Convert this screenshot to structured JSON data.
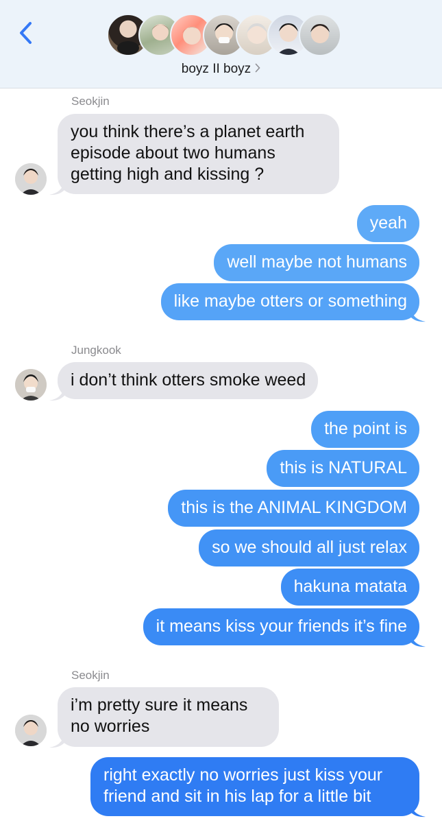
{
  "header": {
    "group_name": "boyz II boyz",
    "back_icon": "chevron-left-icon",
    "accent": "#3478f6"
  },
  "messages": [
    {
      "sender": "Seokjin",
      "text": "you think there’s a planet earth episode about two humans getting high and kissing ?",
      "lines": [
        "you think there’s a planet earth",
        "episode about two humans",
        "getting high and kissing ?"
      ],
      "incoming": true
    },
    {
      "text": "yeah",
      "incoming": false
    },
    {
      "text": "well maybe not humans",
      "incoming": false
    },
    {
      "text": "like maybe otters or something",
      "incoming": false
    },
    {
      "sender": "Jungkook",
      "text": "i don’t think otters smoke weed",
      "incoming": true
    },
    {
      "text": "the point is",
      "incoming": false
    },
    {
      "text": "this is NATURAL",
      "incoming": false
    },
    {
      "text": "this is the ANIMAL KINGDOM",
      "incoming": false
    },
    {
      "text": "so we should all just relax",
      "incoming": false
    },
    {
      "text": "hakuna matata",
      "incoming": false
    },
    {
      "text": "it means kiss your friends it’s fine",
      "incoming": false
    },
    {
      "sender": "Seokjin",
      "text": "i’m pretty sure it means no worries",
      "lines": [
        "i’m pretty sure it means",
        "no worries"
      ],
      "incoming": true
    },
    {
      "text": "right exactly no worries just kiss your friend and sit in his lap for a little bit",
      "lines": [
        "right exactly no worries just kiss your",
        "friend and sit in his lap for a little bit"
      ],
      "incoming": false
    }
  ],
  "colors": {
    "incoming_bubble": "#e5e5ea",
    "outgoing_light": "#5eaaf7",
    "outgoing_dark": "#2f7cf3"
  }
}
